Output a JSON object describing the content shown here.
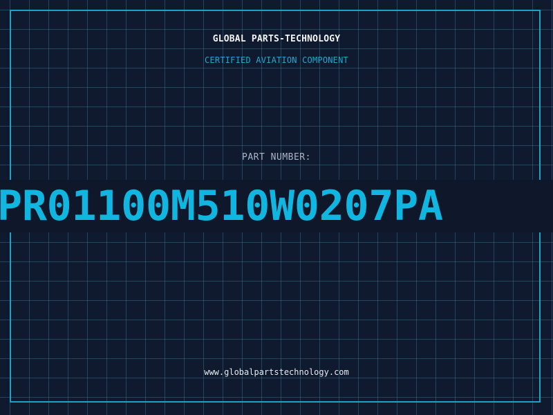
{
  "brand": {
    "name": "GLOBAL PARTS-TECHNOLOGY",
    "tagline": "CERTIFIED AVIATION COMPONENT"
  },
  "part": {
    "label": "PART NUMBER:",
    "number": "PR01100M510W0207PA"
  },
  "footer": {
    "website": "www.globalpartstechnology.com"
  },
  "colors": {
    "background": "#101a2e",
    "accent": "#10b5e0",
    "frame": "#1aa3c8"
  }
}
